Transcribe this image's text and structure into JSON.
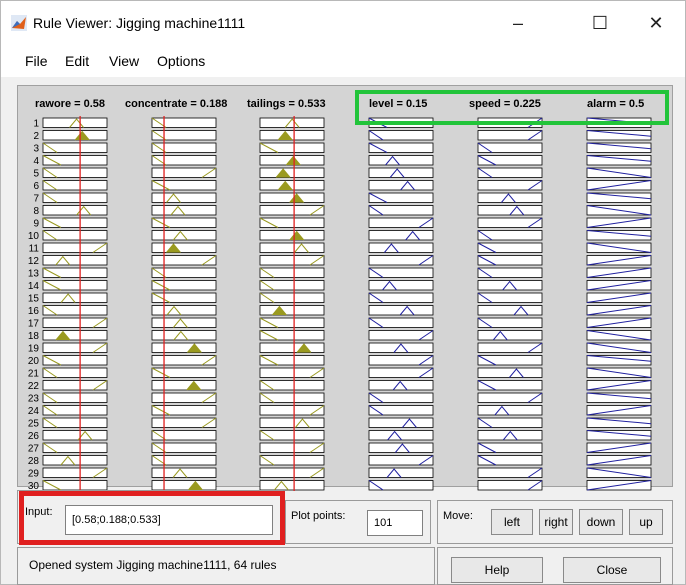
{
  "window": {
    "title": "Rule Viewer: Jigging machine1111",
    "minimize": "–",
    "maximize": "☐",
    "close": "✕"
  },
  "menu": [
    "File",
    "Edit",
    "View",
    "Options"
  ],
  "inputs": [
    {
      "label": "rawore = 0.58",
      "value": 0.58
    },
    {
      "label": "concentrate = 0.188",
      "value": 0.188
    },
    {
      "label": "tailings = 0.533",
      "value": 0.533
    }
  ],
  "outputs": [
    {
      "label": "level = 0.15"
    },
    {
      "label": "speed = 0.225"
    },
    {
      "label": "alarm = 0.5"
    }
  ],
  "rule_numbers": [
    "1",
    "2",
    "3",
    "4",
    "5",
    "6",
    "7",
    "8",
    "9",
    "10",
    "11",
    "12",
    "13",
    "14",
    "15",
    "16",
    "17",
    "18",
    "19",
    "20",
    "21",
    "22",
    "23",
    "24",
    "25",
    "26",
    "27",
    "28",
    "29",
    "30"
  ],
  "controls": {
    "input_label": "Input:",
    "input_value": "[0.58;0.188;0.533]",
    "plot_points_label": "Plot points:",
    "plot_points_value": "101",
    "move_label": "Move:",
    "left": "left",
    "right": "right",
    "down": "down",
    "up": "up",
    "help": "Help",
    "close": "Close"
  },
  "status": "Opened system Jigging machine1111, 64 rules",
  "colors": {
    "input_mf": "#9a9a20",
    "output_mf": "#2020a0",
    "indicator": "#e02020",
    "highlight_green": "#22c43a",
    "highlight_red": "#e02020"
  }
}
